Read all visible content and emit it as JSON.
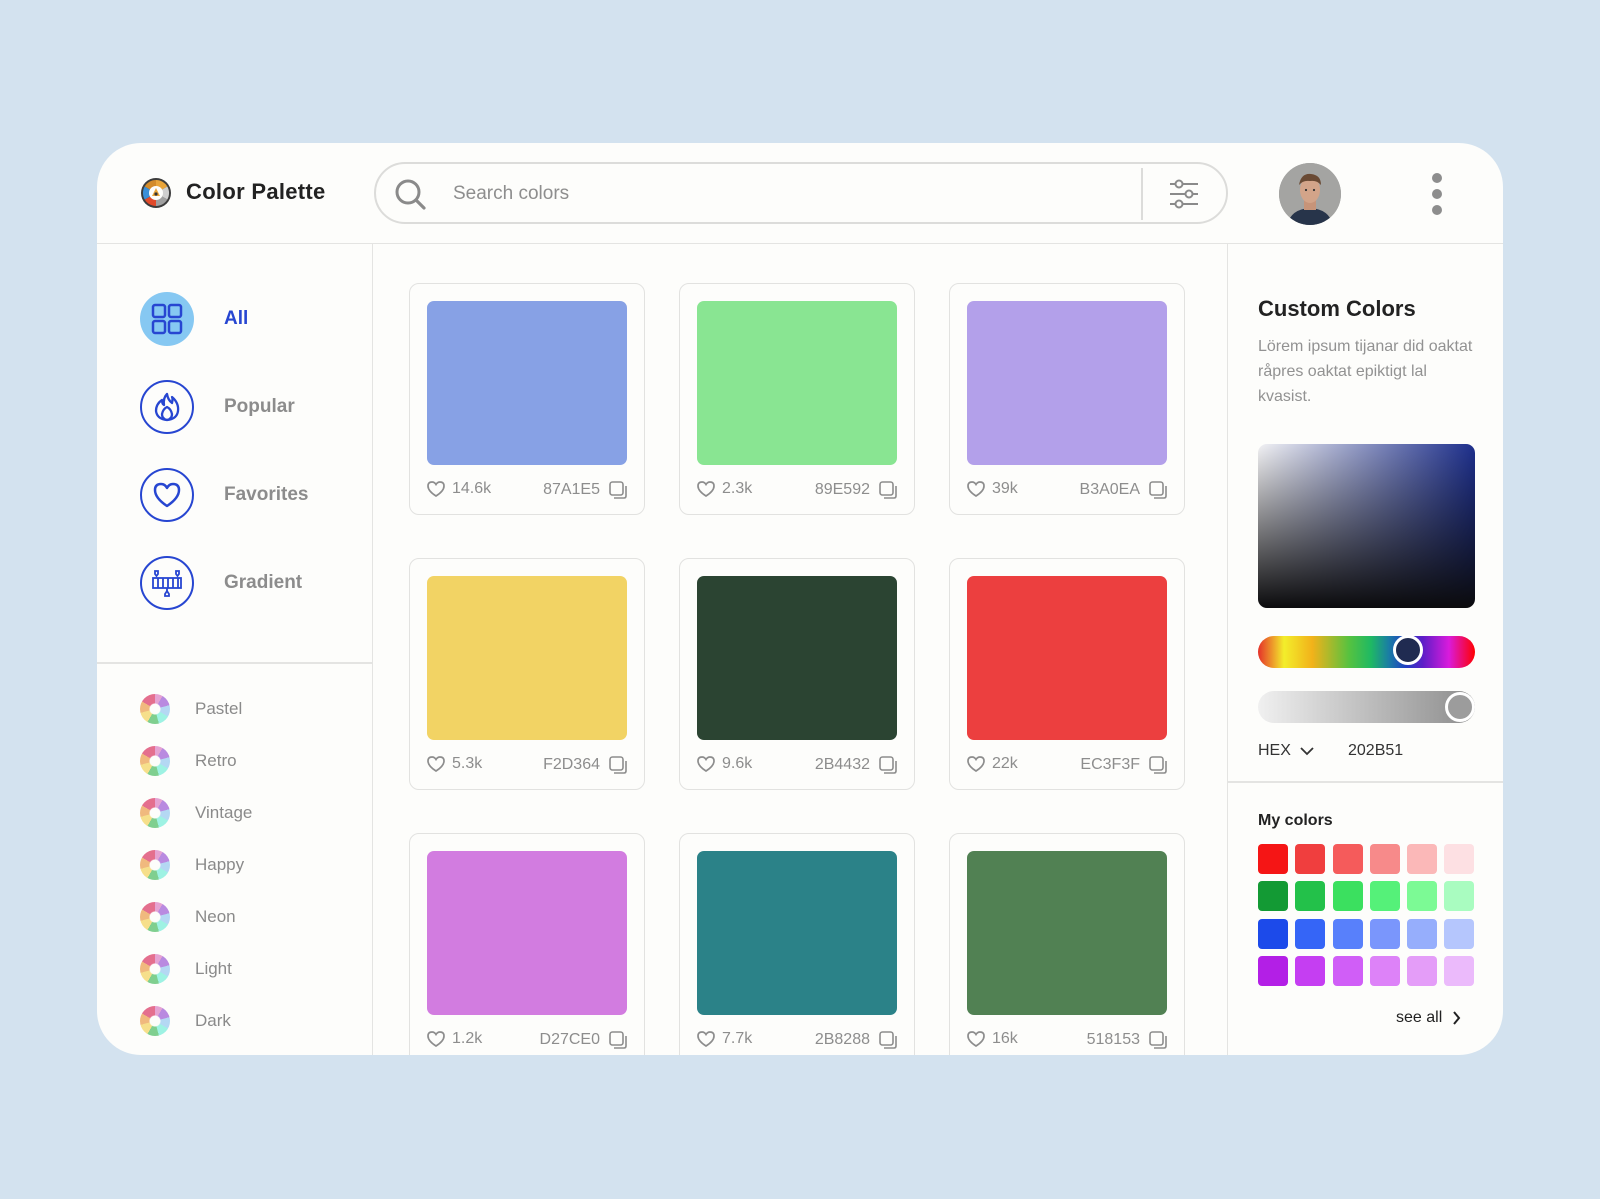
{
  "header": {
    "brand": "Color Palette",
    "search_placeholder": "Search colors",
    "search_value": ""
  },
  "sidebar": {
    "nav": [
      {
        "label": "All",
        "icon": "grid-icon",
        "active": true
      },
      {
        "label": "Popular",
        "icon": "flame-icon",
        "active": false
      },
      {
        "label": "Favorites",
        "icon": "heart-icon",
        "active": false
      },
      {
        "label": "Gradient",
        "icon": "gradient-icon",
        "active": false
      }
    ],
    "categories": [
      "Pastel",
      "Retro",
      "Vintage",
      "Happy",
      "Neon",
      "Light",
      "Dark"
    ]
  },
  "palette": [
    {
      "color": "#87A1E5",
      "hex": "87A1E5",
      "likes": "14.6k"
    },
    {
      "color": "#89E592",
      "hex": "89E592",
      "likes": "2.3k"
    },
    {
      "color": "#B3A0EA",
      "hex": "B3A0EA",
      "likes": "39k"
    },
    {
      "color": "#F2D364",
      "hex": "F2D364",
      "likes": "5.3k"
    },
    {
      "color": "#2B4432",
      "hex": "2B4432",
      "likes": "9.6k"
    },
    {
      "color": "#EC3F3F",
      "hex": "EC3F3F",
      "likes": "22k"
    },
    {
      "color": "#D27CE0",
      "hex": "D27CE0",
      "likes": "1.2k"
    },
    {
      "color": "#2B8288",
      "hex": "2B8288",
      "likes": "7.7k"
    },
    {
      "color": "#518153",
      "hex": "518153",
      "likes": "16k"
    }
  ],
  "custom_colors": {
    "title": "Custom Colors",
    "description": "Lörem ipsum tijanar did oaktat råpres oaktat epiktigt lal kvasist.",
    "hue_position": 0.69,
    "alpha_position": 0.93,
    "format": "HEX",
    "hex_value": "202B51",
    "selected_color": "#202B51"
  },
  "my_colors": {
    "title": "My colors",
    "see_all": "see all",
    "swatches": [
      "#F51515",
      "#F03E3E",
      "#F55B5B",
      "#F78A8A",
      "#FBB8B8",
      "#FDE0E3",
      "#139A34",
      "#23C14A",
      "#3BE05F",
      "#55F179",
      "#7CFA95",
      "#A9FCC0",
      "#1C4AEA",
      "#3565F7",
      "#5880FB",
      "#7A96FC",
      "#96AEFC",
      "#B5C6FD",
      "#B31FE6",
      "#C53EF2",
      "#D05EF7",
      "#DD82F8",
      "#E49DF8",
      "#EBBAFB"
    ]
  }
}
